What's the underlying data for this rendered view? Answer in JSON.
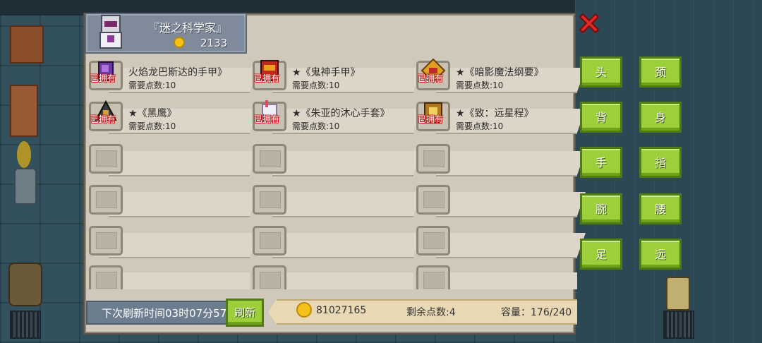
{
  "header": {
    "title": "『迷之科学家』",
    "coins": "2133"
  },
  "items": [
    {
      "owned": "已拥有",
      "name": "火焰龙巴斯达的手甲》",
      "cost": "需要点数:10",
      "icon": "flame-gauntlet-icon",
      "color": "#c0392b"
    },
    {
      "owned": "已拥有",
      "name": "★《鬼神手甲》",
      "cost": "需要点数:10",
      "icon": "demon-gauntlet-icon",
      "color": "#e05a1a"
    },
    {
      "owned": "已拥有",
      "name": "★《暗影魔法纲要》",
      "cost": "需要点数:10",
      "icon": "shadow-tome-icon",
      "color": "#d8a020"
    },
    {
      "owned": "已拥有",
      "name": "★《黑鹰》",
      "cost": "需要点数:10",
      "icon": "black-hawk-icon",
      "color": "#555555"
    },
    {
      "owned": "已拥有",
      "name": "★《朱亚的沐心手套》",
      "cost": "需要点数:10",
      "icon": "glove-icon",
      "color": "#e8e0f0"
    },
    {
      "owned": "已拥有",
      "name": "★《致：远星程》",
      "cost": "需要点数:10",
      "icon": "star-bracer-icon",
      "color": "#c88a20"
    }
  ],
  "equip_buttons": [
    "头",
    "颈",
    "背",
    "身",
    "手",
    "指",
    "腕",
    "腰",
    "足",
    "远"
  ],
  "footer": {
    "refresh_timer": "下次刷新时间03时07分57",
    "refresh_label": "刷新",
    "gold": "81027165",
    "points_remaining": "剩余点数:4",
    "capacity": "容量：176/240"
  }
}
